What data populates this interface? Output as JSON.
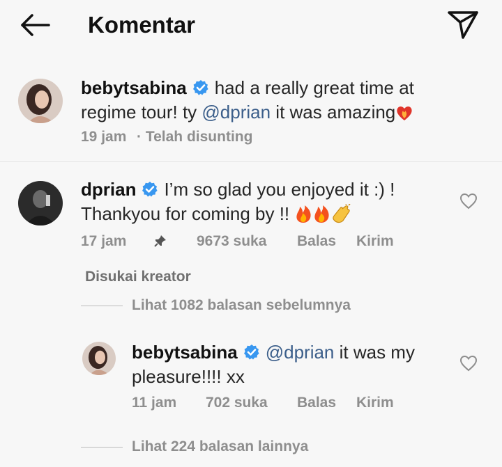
{
  "header": {
    "title": "Komentar"
  },
  "caption": {
    "username": "bebytsabina",
    "text_before": "had a really great time at regime tour! ty ",
    "mention": "@dprian",
    "text_after": " it was amazing",
    "time": "19 jam",
    "edited": "· Telah disunting"
  },
  "comment": {
    "username": "dprian",
    "text": "I’m so glad you enjoyed it :) ! Thankyou for coming by !!",
    "time": "17 jam",
    "likes": "9673 suka",
    "reply_label": "Balas",
    "send_label": "Kirim",
    "liked_by_creator": "Disukai kreator",
    "view_previous": "Lihat 1082 balasan sebelumnya"
  },
  "reply": {
    "username": "bebytsabina",
    "mention": "@dprian",
    "text": " it was my pleasure!!!! xx",
    "time": "11 jam",
    "likes": "702 suka",
    "reply_label": "Balas",
    "send_label": "Kirim",
    "view_more": "Lihat 224 balasan lainnya"
  },
  "icons": {
    "back": "arrow-left-icon",
    "send": "paper-plane-icon",
    "verified": "verified-badge-icon",
    "heart": "heart-outline-icon",
    "pin": "pin-icon",
    "fire": "fire-emoji",
    "clap": "clap-emoji",
    "heart_fire": "heart-on-fire-emoji"
  },
  "colors": {
    "mention": "#3b5e8a",
    "verified": "#3897f0",
    "muted": "#8e8e8e"
  }
}
